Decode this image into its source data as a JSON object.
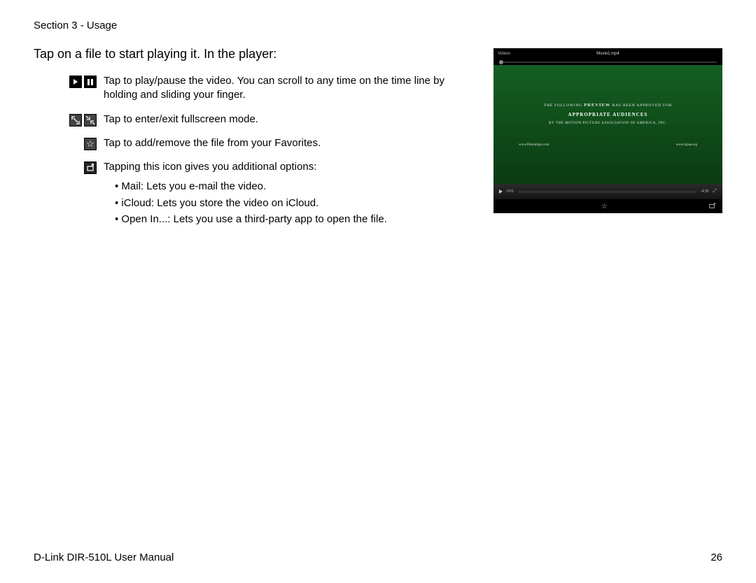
{
  "header": "Section 3 - Usage",
  "intro": "Tap on a file to start playing it. In the player:",
  "rows": [
    {
      "desc": "Tap to play/pause the video. You can scroll to any time on the time line by holding and sliding your finger."
    },
    {
      "desc": "Tap to enter/exit fullscreen mode."
    },
    {
      "desc": "Tap to add/remove the file from your Favorites."
    },
    {
      "desc": "Tapping this icon gives you additional options:"
    }
  ],
  "options": [
    {
      "term": "Mail:",
      "body": " Lets you e-mail the video."
    },
    {
      "term": "iCloud:",
      "body": " Lets you store the video on iCloud."
    },
    {
      "term": "Open In...:",
      "body": " Lets you use a third-party app to open the file."
    }
  ],
  "video": {
    "back": "Videos",
    "title": "Movie1.mp4",
    "line1_a": "THE FOLLOWING ",
    "line1_b": "PREVIEW",
    "line1_c": " HAS BEEN APPROVED FOR",
    "line2": "APPROPRIATE AUDIENCES",
    "line3": "BY THE MOTION PICTURE ASSOCIATION OF AMERICA, INC.",
    "url1": "www.filmratings.com",
    "url2": "www.mpaa.org",
    "t1": "0:01",
    "t2": "-4:35"
  },
  "footer_left": "D-Link DIR-510L User Manual",
  "footer_right": "26"
}
